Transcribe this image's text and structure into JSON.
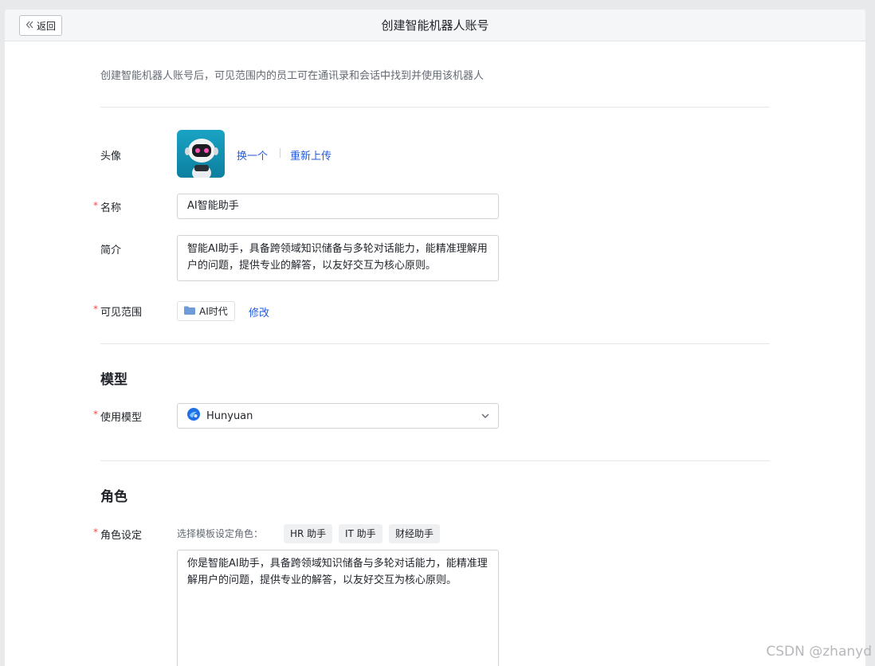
{
  "header": {
    "back_label": "返回",
    "title": "创建智能机器人账号"
  },
  "intro": "创建智能机器人账号后，可见范围内的员工可在通讯录和会话中找到并使用该机器人",
  "avatar": {
    "label": "头像",
    "change_label": "换一个",
    "reupload_label": "重新上传"
  },
  "name_field": {
    "label": "名称",
    "value": "AI智能助手"
  },
  "intro_field": {
    "label": "简介",
    "value": "智能AI助手，具备跨领域知识储备与多轮对话能力，能精准理解用户的问题，提供专业的解答，以友好交互为核心原则。"
  },
  "scope": {
    "label": "可见范围",
    "tag": "AI时代",
    "edit_label": "修改"
  },
  "model_section": {
    "title": "模型",
    "label": "使用模型",
    "selected": "Hunyuan"
  },
  "role_section": {
    "title": "角色",
    "label": "角色设定",
    "template_prompt": "选择模板设定角色：",
    "templates": [
      "HR 助手",
      "IT 助手",
      "财经助手"
    ],
    "prompt_value": "你是智能AI助手，具备跨领域知识储备与多轮对话能力，能精准理解用户的问题，提供专业的解答，以友好交互为核心原则。"
  },
  "required_mark": "*",
  "watermark": "CSDN @zhanyd",
  "colors": {
    "link": "#245bdb",
    "required": "#f54a45",
    "border": "#d0d3d6"
  }
}
